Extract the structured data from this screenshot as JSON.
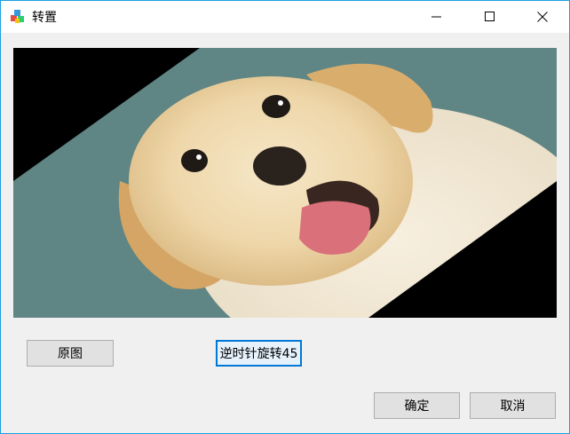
{
  "window": {
    "title": "转置",
    "app_icon": "app-icon",
    "controls": {
      "minimize_icon": "minimize-icon",
      "maximize_icon": "maximize-icon",
      "close_icon": "close-icon"
    }
  },
  "image": {
    "content": "rotated photo of a puppy",
    "rotation_label": "逆时针旋转45"
  },
  "buttons": {
    "original": "原图",
    "rotate": "逆时针旋转45",
    "ok": "确定",
    "cancel": "取消"
  },
  "colors": {
    "window_border": "#1ba1e2",
    "focus_border": "#0078d7",
    "background": "#f0f0f0",
    "button_face": "#e1e1e1"
  }
}
